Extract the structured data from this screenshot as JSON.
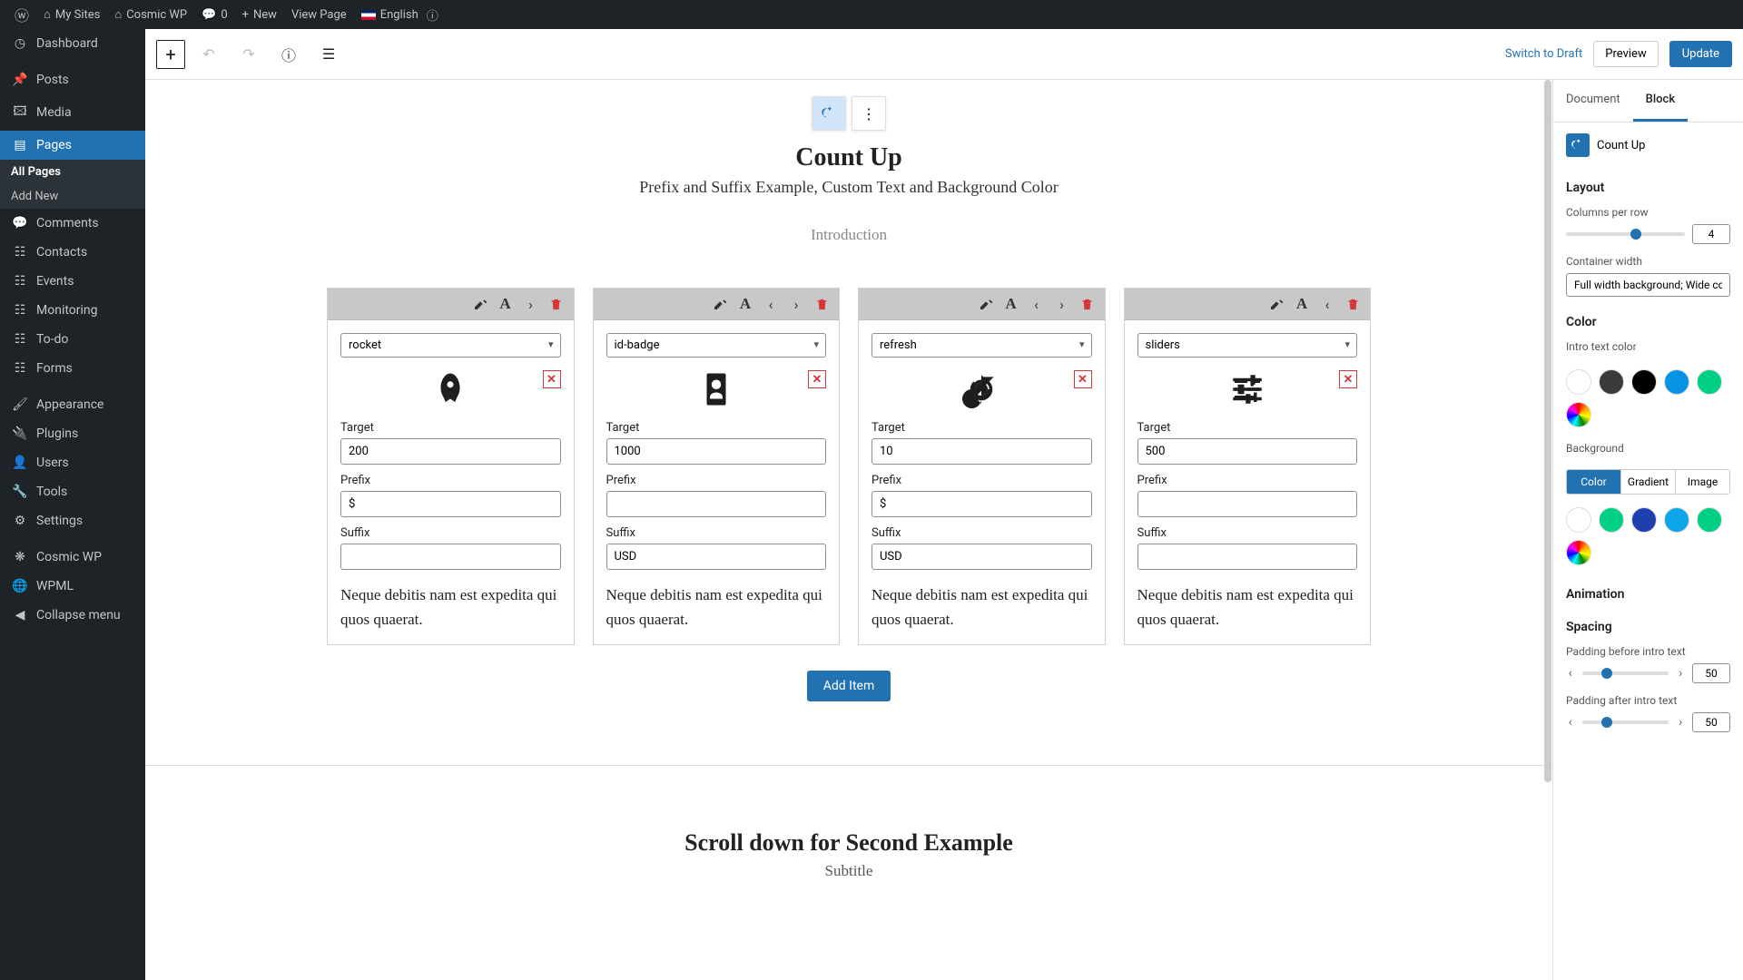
{
  "adminbar": {
    "mysites": "My Sites",
    "sitename": "Cosmic WP",
    "comments": "0",
    "new": "New",
    "viewpage": "View Page",
    "lang": "English"
  },
  "sidebar": {
    "dashboard": "Dashboard",
    "posts": "Posts",
    "media": "Media",
    "pages": "Pages",
    "allpages": "All Pages",
    "addnew": "Add New",
    "comments": "Comments",
    "contacts": "Contacts",
    "events": "Events",
    "monitoring": "Monitoring",
    "todo": "To-do",
    "forms": "Forms",
    "appearance": "Appearance",
    "plugins": "Plugins",
    "users": "Users",
    "tools": "Tools",
    "settings": "Settings",
    "cosmic": "Cosmic WP",
    "wpml": "WPML",
    "collapse": "Collapse menu"
  },
  "toolbar": {
    "switch": "Switch to Draft",
    "preview": "Preview",
    "update": "Update"
  },
  "block": {
    "title": "Count Up",
    "subtitle": "Prefix and Suffix Example, Custom Text and Background Color",
    "intro": "Introduction",
    "additem": "Add Item",
    "second_title": "Scroll down for Second Example",
    "second_sub": "Subtitle"
  },
  "labels": {
    "target": "Target",
    "prefix": "Prefix",
    "suffix": "Suffix"
  },
  "cols": [
    {
      "icon": "rocket",
      "target": "200",
      "prefix": "$",
      "suffix": "",
      "desc": "Neque debitis nam est expedita qui quos quaerat.",
      "first": true
    },
    {
      "icon": "id-badge",
      "target": "1000",
      "prefix": "",
      "suffix": "USD",
      "desc": "Neque debitis nam est expedita qui quos quaerat."
    },
    {
      "icon": "refresh",
      "target": "10",
      "prefix": "$",
      "suffix": "USD",
      "desc": "Neque debitis nam est expedita qui quos quaerat."
    },
    {
      "icon": "sliders",
      "target": "500",
      "prefix": "",
      "suffix": "",
      "desc": "Neque debitis nam est expedita qui quos quaerat.",
      "last": true
    }
  ],
  "inspector": {
    "tab_doc": "Document",
    "tab_block": "Block",
    "blockname": "Count Up",
    "layout": "Layout",
    "cols_per_row": "Columns per row",
    "container_width": "Container width",
    "container_value": "Full width background; Wide co",
    "color": "Color",
    "intro_color": "Intro text color",
    "background": "Background",
    "seg_color": "Color",
    "seg_gradient": "Gradient",
    "seg_image": "Image",
    "animation": "Animation",
    "spacing": "Spacing",
    "pad_before": "Padding before intro text",
    "pad_after": "Padding after intro text",
    "pad_val": "50"
  }
}
